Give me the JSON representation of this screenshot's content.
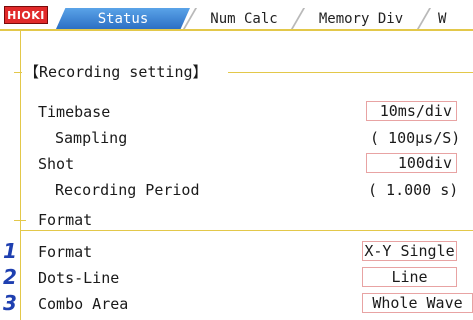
{
  "header": {
    "logo": "HIOKI",
    "tabs": [
      {
        "label": "Status",
        "active": true
      },
      {
        "label": "Num Calc",
        "active": false
      },
      {
        "label": "Memory Div",
        "active": false
      },
      {
        "label": "W",
        "active": false
      }
    ]
  },
  "recording": {
    "title": "【Recording setting】",
    "timebase_label": "Timebase",
    "timebase_value": "10ms/div",
    "sampling_label": "Sampling",
    "sampling_value": "( 100µs/S)",
    "shot_label": "Shot",
    "shot_value": "100div",
    "period_label": "Recording Period",
    "period_value": "( 1.000 s)"
  },
  "format": {
    "section_title": "Format",
    "rows": [
      {
        "marker": "1",
        "label": "Format",
        "value": "X-Y Single"
      },
      {
        "marker": "2",
        "label": "Dots-Line",
        "value": "Line"
      },
      {
        "marker": "3",
        "label": "Combo Area",
        "value": "Whole Wave"
      }
    ]
  },
  "colors": {
    "accent_line": "#e3c84a",
    "value_border": "#e8a3a3",
    "active_tab": "#2c6fc4",
    "logo": "#e12a2a",
    "marker": "#1e3fb0"
  }
}
